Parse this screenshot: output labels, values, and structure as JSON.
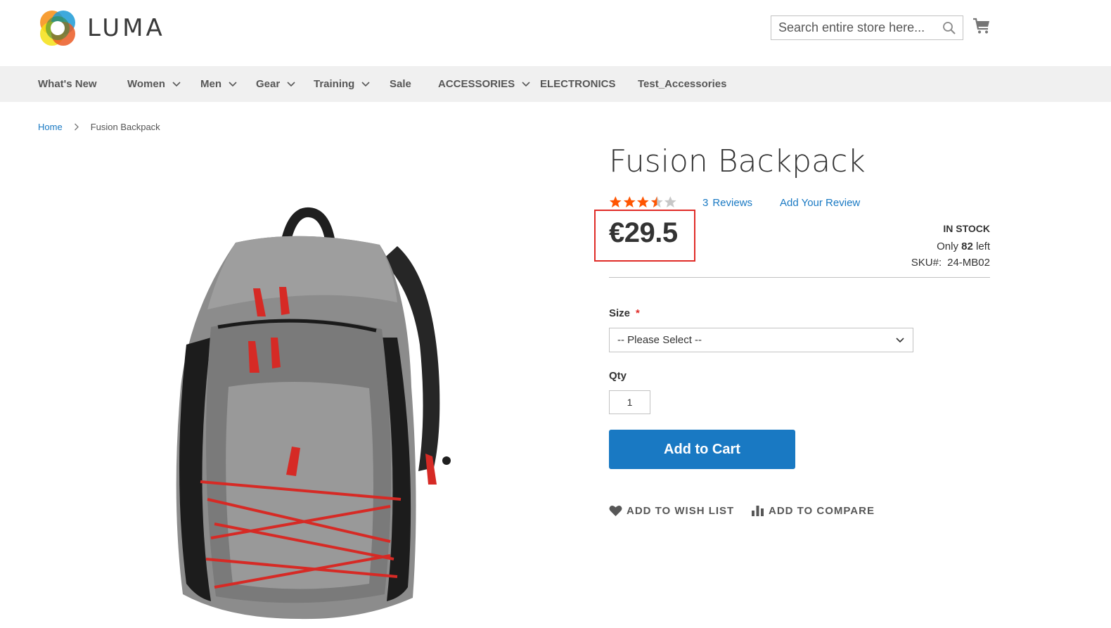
{
  "header": {
    "logo_text": "LUMA",
    "search_placeholder": "Search entire store here...",
    "icons": {
      "search": "search-icon",
      "cart": "cart-icon"
    }
  },
  "nav": {
    "items": [
      {
        "label": "What's New",
        "has_dropdown": false
      },
      {
        "label": "Women",
        "has_dropdown": true
      },
      {
        "label": "Men",
        "has_dropdown": true
      },
      {
        "label": "Gear",
        "has_dropdown": true
      },
      {
        "label": "Training",
        "has_dropdown": true
      },
      {
        "label": "Sale",
        "has_dropdown": false
      },
      {
        "label": "ACCESSORIES",
        "has_dropdown": true
      },
      {
        "label": "ELECTRONICS",
        "has_dropdown": false
      },
      {
        "label": "Test_Accessories",
        "has_dropdown": false
      }
    ]
  },
  "breadcrumb": {
    "home": "Home",
    "current": "Fusion Backpack"
  },
  "product": {
    "title": "Fusion Backpack",
    "rating_stars": 3.5,
    "rating_max": 5,
    "reviews_count": "3",
    "reviews_label": "Reviews",
    "add_review_label": "Add Your Review",
    "price": "€29.5",
    "stock_status": "IN STOCK",
    "only_prefix": "Only",
    "only_count": "82",
    "only_suffix": "left",
    "sku_label": "SKU#:",
    "sku_value": "24-MB02",
    "size_label": "Size",
    "size_required_marker": "*",
    "size_selected": "-- Please Select --",
    "qty_label": "Qty",
    "qty_value": "1",
    "add_to_cart_label": "Add to Cart",
    "wishlist_label": "Add to Wish List",
    "compare_label": "Add to Compare"
  },
  "colors": {
    "accent_blue": "#1979c3",
    "star_orange": "#ff5501",
    "highlight_red": "#e02b27",
    "nav_bg": "#f0f0f0"
  }
}
